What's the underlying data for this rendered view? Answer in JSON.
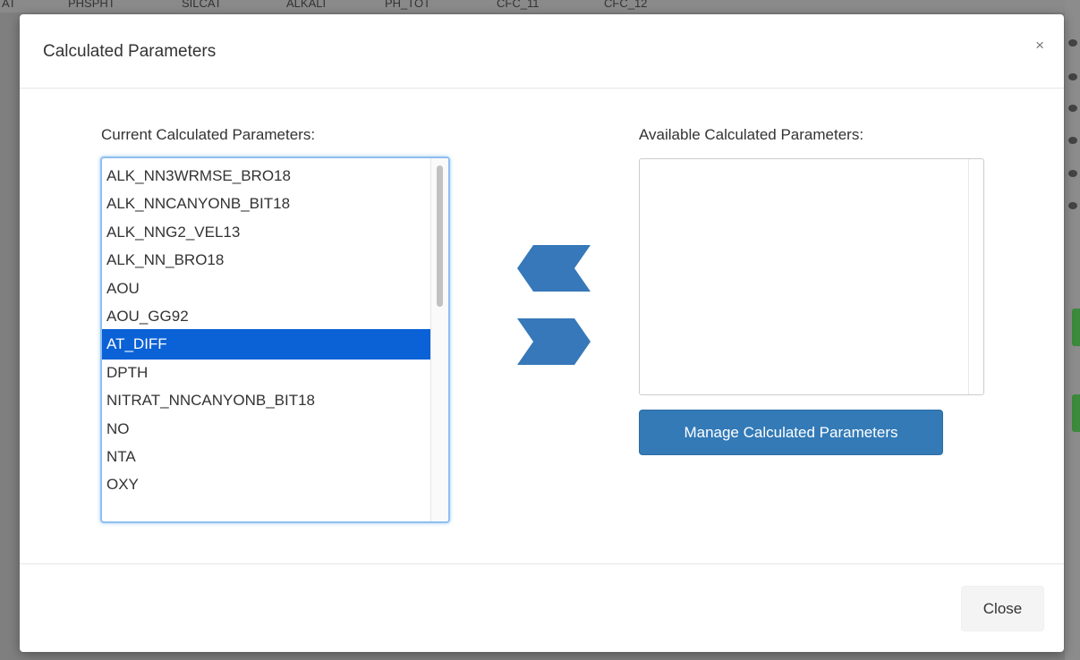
{
  "background": {
    "column_headers": [
      "AT",
      "PHSPHT",
      "SILCAT",
      "ALKALI",
      "PH_TOT",
      "CFC_11",
      "CFC_12"
    ]
  },
  "modal": {
    "title": "Calculated Parameters",
    "close_icon": "×",
    "current_label": "Current Calculated Parameters:",
    "available_label": "Available Calculated Parameters:",
    "current_items": [
      "ALK_NN3WRMSE_BRO18",
      "ALK_NNCANYONB_BIT18",
      "ALK_NNG2_VEL13",
      "ALK_NN_BRO18",
      "AOU",
      "AOU_GG92",
      "AT_DIFF",
      "DPTH",
      "NITRAT_NNCANYONB_BIT18",
      "NO",
      "NTA",
      "OXY"
    ],
    "selected_item": "AT_DIFF",
    "available_items": [],
    "manage_button": "Manage Calculated Parameters",
    "close_button": "Close"
  },
  "colors": {
    "accent": "#337ab7",
    "selection": "#0b61d6",
    "arrow": "#3678b9"
  }
}
